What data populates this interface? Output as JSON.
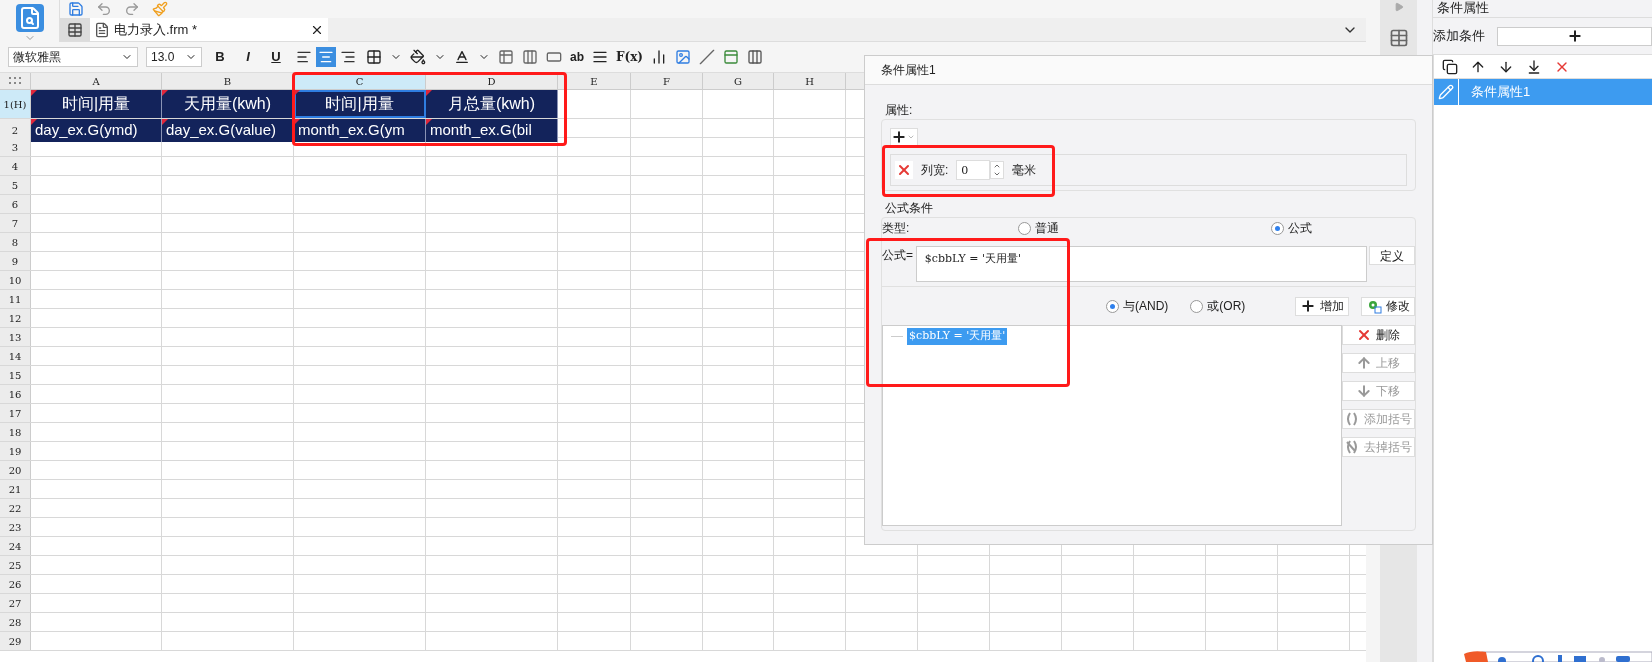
{
  "document_tab": {
    "title": "电力录入.frm *",
    "selected": true
  },
  "format_toolbar": {
    "font": "微软雅黑",
    "size": "13.0",
    "styles": [
      "B",
      "I",
      "U"
    ],
    "alignments": [
      {
        "kind": "left",
        "selected": false
      },
      {
        "kind": "center",
        "selected": true
      },
      {
        "kind": "right",
        "selected": false
      }
    ],
    "text_tools": [
      "ab",
      "F(x)"
    ]
  },
  "sheet": {
    "columns": [
      {
        "label": "A",
        "selected": false
      },
      {
        "label": "B",
        "selected": false
      },
      {
        "label": "C",
        "selected": true
      },
      {
        "label": "D",
        "selected": false
      },
      {
        "label": "E",
        "selected": false
      },
      {
        "label": "F",
        "selected": false
      },
      {
        "label": "G",
        "selected": false
      },
      {
        "label": "H",
        "selected": false
      }
    ],
    "rows": [
      {
        "label": "1(H)",
        "selected": true,
        "kind": "header",
        "cells": [
          {
            "text": "时间|用量",
            "selected": false
          },
          {
            "text": "天用量(kwh)",
            "selected": false
          },
          {
            "text": "时间|用量",
            "selected": true
          },
          {
            "text": "月总量(kwh)",
            "selected": false
          }
        ]
      },
      {
        "label": "2",
        "selected": false,
        "kind": "data",
        "cells": [
          {
            "text": "day_ex.G(ymd)",
            "selected": false
          },
          {
            "text": "day_ex.G(value)",
            "selected": false
          },
          {
            "text": "month_ex.G(ym",
            "selected": false
          },
          {
            "text": "month_ex.G(bil",
            "selected": false
          }
        ]
      },
      {
        "label": "3",
        "selected": false
      },
      {
        "label": "4",
        "selected": false
      },
      {
        "label": "5",
        "selected": false
      },
      {
        "label": "6",
        "selected": false
      },
      {
        "label": "7",
        "selected": false
      },
      {
        "label": "8",
        "selected": false
      },
      {
        "label": "9",
        "selected": false
      },
      {
        "label": "10",
        "selected": false
      },
      {
        "label": "11",
        "selected": false
      },
      {
        "label": "12",
        "selected": false
      },
      {
        "label": "13",
        "selected": false
      },
      {
        "label": "14",
        "selected": false
      },
      {
        "label": "15",
        "selected": false
      },
      {
        "label": "16",
        "selected": false
      },
      {
        "label": "17",
        "selected": false
      },
      {
        "label": "18",
        "selected": false
      },
      {
        "label": "19",
        "selected": false
      },
      {
        "label": "20",
        "selected": false
      },
      {
        "label": "21",
        "selected": false
      },
      {
        "label": "22",
        "selected": false
      },
      {
        "label": "23",
        "selected": false
      },
      {
        "label": "24",
        "selected": false
      },
      {
        "label": "25",
        "selected": false
      },
      {
        "label": "26",
        "selected": false
      },
      {
        "label": "27",
        "selected": false
      },
      {
        "label": "28",
        "selected": false
      },
      {
        "label": "29",
        "selected": false
      }
    ]
  },
  "dialog": {
    "title": "条件属性1",
    "properties_label": "属性:",
    "property": {
      "label": "列宽:",
      "value": "0",
      "unit": "毫米"
    },
    "formula_condition": {
      "label": "公式条件",
      "type_label": "类型:",
      "types": [
        {
          "label": "普通",
          "selected": false
        },
        {
          "label": "公式",
          "selected": true
        }
      ],
      "formula_label": "公式=",
      "formula": "$cbbLY = '天用量'",
      "define_button": "定义",
      "joins": [
        {
          "label": "与(AND)",
          "selected": true
        },
        {
          "label": "或(OR)",
          "selected": false
        }
      ],
      "add_button": "增加",
      "modify_button": "修改",
      "conditions": [
        {
          "text": "$cbbLY = '天用量'",
          "selected": true
        }
      ],
      "side_buttons": [
        {
          "kind": "delete",
          "label": "删除",
          "disabled": false
        },
        {
          "kind": "up",
          "label": "上移",
          "disabled": true
        },
        {
          "kind": "down",
          "label": "下移",
          "disabled": true
        },
        {
          "kind": "add-parens",
          "label": "添加括号",
          "disabled": true
        },
        {
          "kind": "remove-parens",
          "label": "去掉括号",
          "disabled": true
        }
      ]
    }
  },
  "right_panel": {
    "title": "条件属性",
    "add_label": "添加条件",
    "items": [
      {
        "label": "条件属性1",
        "selected": true
      }
    ]
  }
}
